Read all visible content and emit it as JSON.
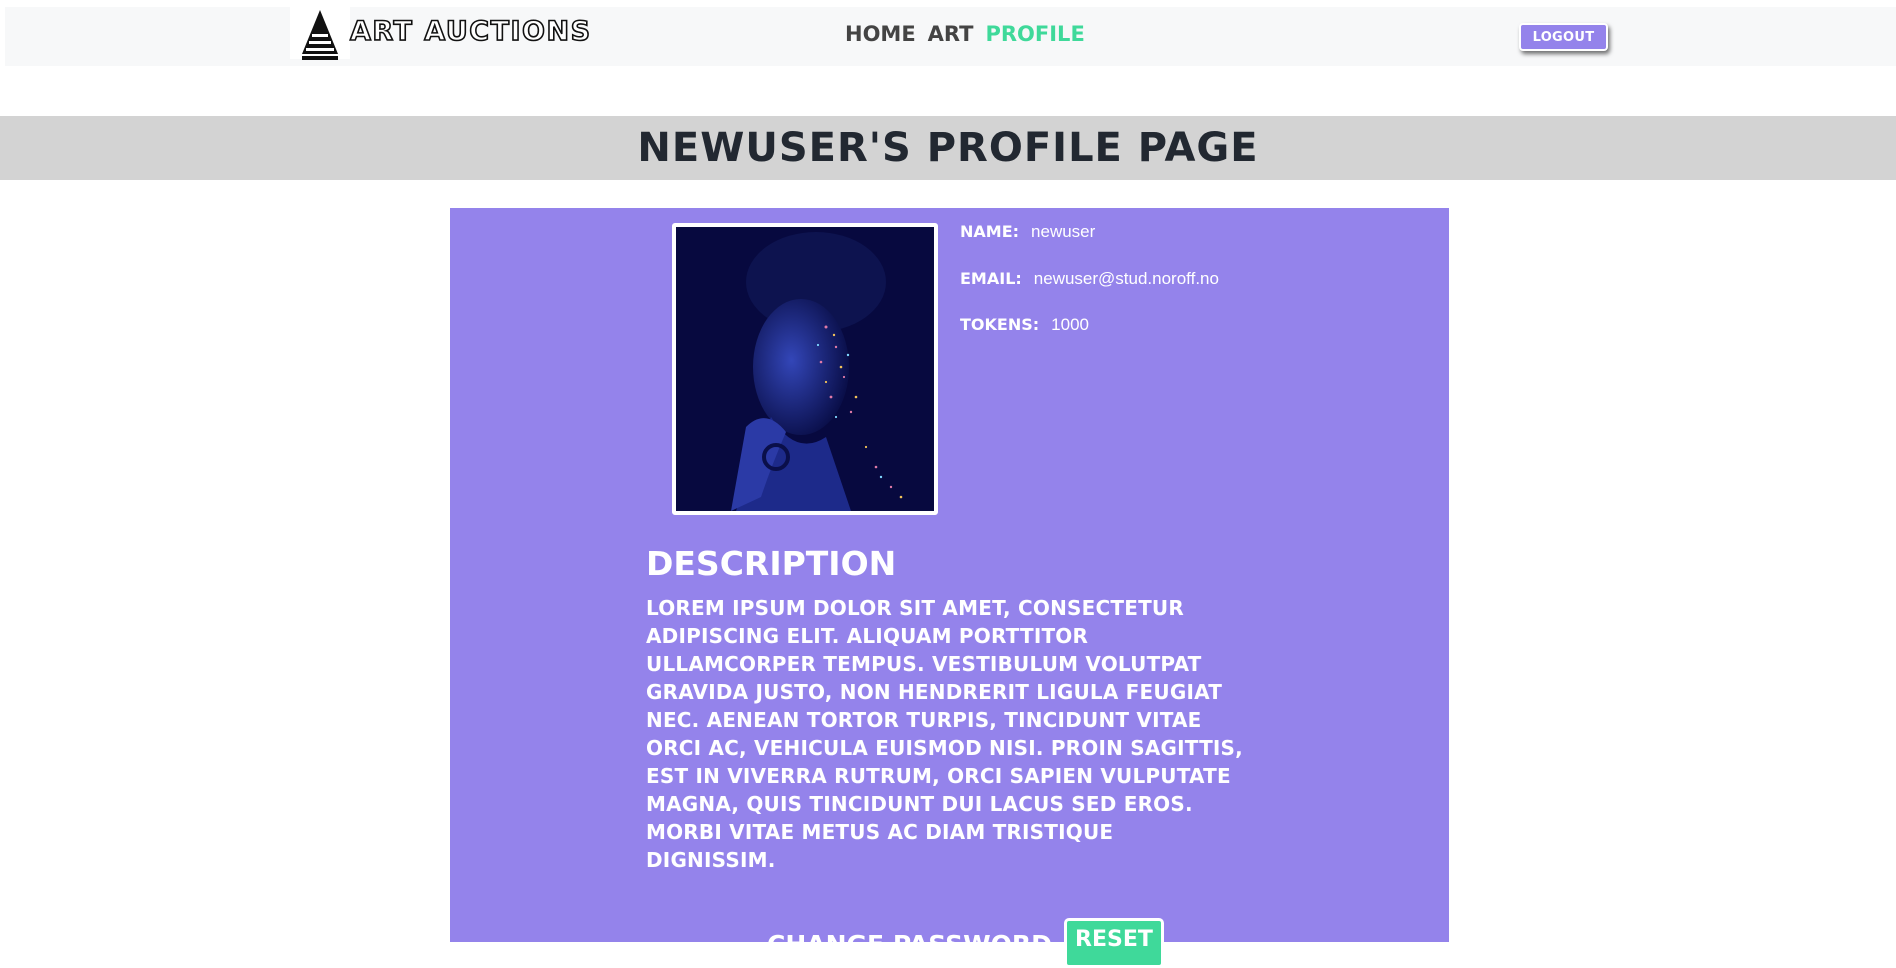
{
  "header": {
    "brand": "ART AUCTIONS",
    "logo_icon": "letter-a-logo-icon",
    "nav": [
      {
        "label": "HOME",
        "active": false
      },
      {
        "label": "ART",
        "active": false
      },
      {
        "label": "PROFILE",
        "active": true
      }
    ],
    "logout_label": "LOGOUT"
  },
  "page": {
    "title": "NEWUSER'S PROFILE PAGE"
  },
  "profile": {
    "avatar_alt": "portrait with glitter face paint",
    "name_label": "NAME:",
    "name_value": "newuser",
    "email_label": "EMAIL:",
    "email_value": "newuser@stud.noroff.no",
    "tokens_label": "TOKENS:",
    "tokens_value": "1000"
  },
  "description": {
    "heading": "DESCRIPTION",
    "text": "LOREM IPSUM DOLOR SIT AMET, CONSECTETUR ADIPISCING ELIT. ALIQUAM PORTTITOR ULLAMCORPER TEMPUS. VESTIBULUM VOLUTPAT GRAVIDA JUSTO, NON HENDRERIT LIGULA FEUGIAT NEC. AENEAN TORTOR TURPIS, TINCIDUNT VITAE ORCI AC, VEHICULA EUISMOD NISI. PROIN SAGITTIS, EST IN VIVERRA RUTRUM, ORCI SAPIEN VULPUTATE MAGNA, QUIS TINCIDUNT DUI LACUS SED EROS. MORBI VITAE METUS AC DIAM TRISTIQUE DIGNISSIM."
  },
  "password": {
    "label": "CHANGE PASSWORD",
    "reset_label": "RESET"
  },
  "colors": {
    "accent_purple": "#9483eb",
    "accent_green": "#3fd99a",
    "title_bar": "#d3d3d3",
    "navbar": "#f7f8f9"
  }
}
